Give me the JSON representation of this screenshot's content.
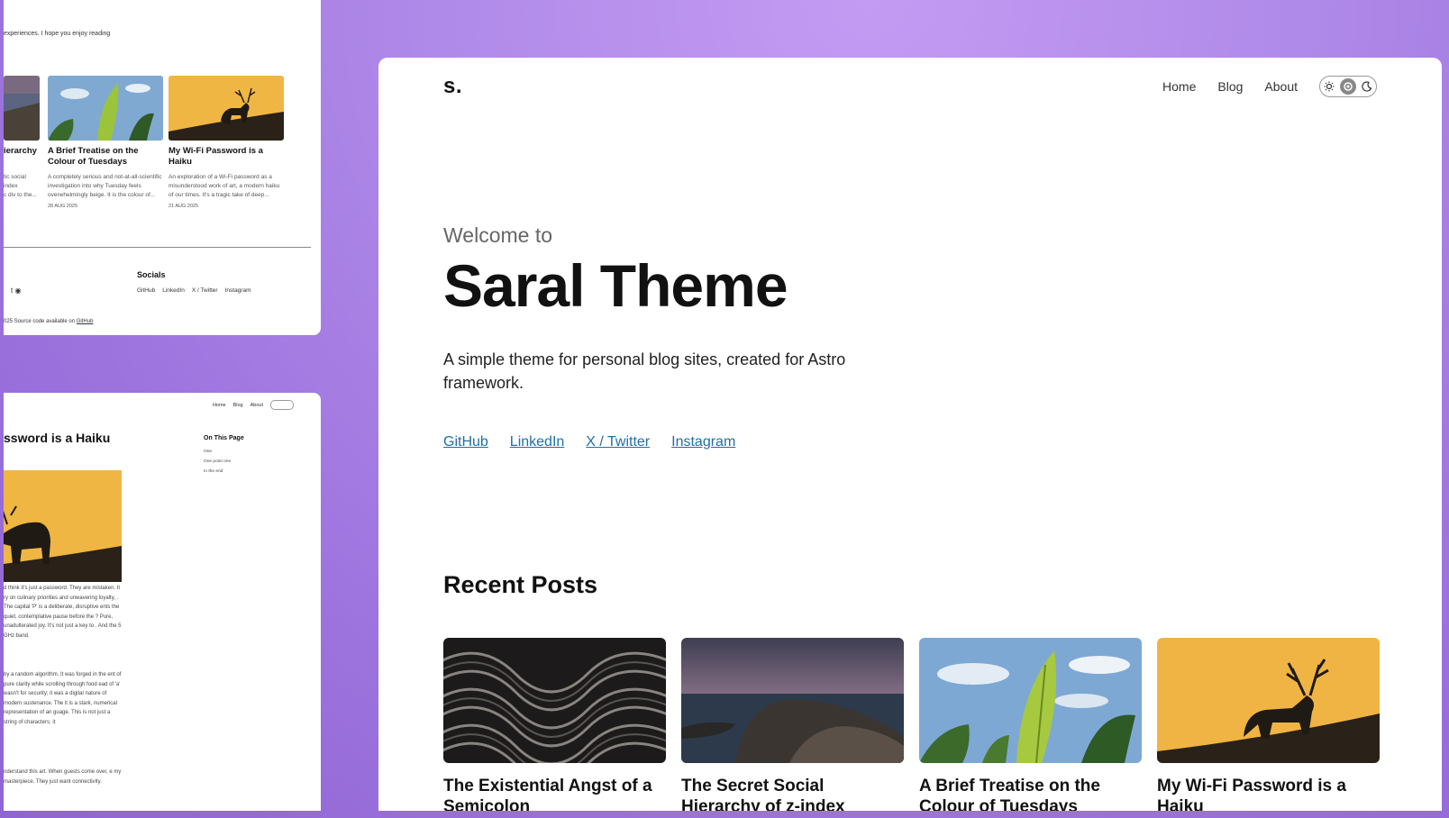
{
  "main": {
    "logo": "s.",
    "nav": [
      "Home",
      "Blog",
      "About"
    ],
    "hero": {
      "welcome": "Welcome to",
      "title": "Saral Theme",
      "subtitle": "A simple theme for personal blog sites, created for Astro framework.",
      "links": [
        "GitHub",
        "LinkedIn",
        "X / Twitter",
        "Instagram"
      ]
    },
    "recent_title": "Recent Posts",
    "posts": [
      {
        "title": "The Existential Angst of a Semicolon",
        "image": "wave-texture"
      },
      {
        "title": "The Secret Social Hierarchy of z-index",
        "image": "coastal-rocks"
      },
      {
        "title": "A Brief Treatise on the Colour of Tuesdays",
        "image": "banana-leaves"
      },
      {
        "title": "My Wi-Fi Password is a Haiku",
        "image": "stag-silhouette"
      }
    ]
  },
  "top_left": {
    "intro": "experiences. I hope you enjoy reading",
    "partial_title": "ierarchy",
    "partial_desc": "tic social\nindex\nc div to the...",
    "posts": [
      {
        "title": "A Brief Treatise on the Colour of Tuesdays",
        "desc": "A completely serious and not-at-all-scientific investigation into why Tuesday feels overwhelmingly beige. It is the colour of...",
        "date": "28 AUG 2025"
      },
      {
        "title": "My Wi-Fi Password is a Haiku",
        "desc": "An exploration of a Wi-Fi password as a misunderstood work of art, a modern haiku of our times. It's a tragic take of deep...",
        "date": "21 AUG 2025"
      }
    ],
    "socials_heading": "Socials",
    "socials": [
      "GitHub",
      "LinkedIn",
      "X / Twitter",
      "Instagram"
    ],
    "rss_partial": "t",
    "footer_prefix": "025 Source code available on ",
    "footer_link": "GitHub"
  },
  "bottom_left": {
    "nav": [
      "Home",
      "Blog",
      "About"
    ],
    "title": "ssword is a Haiku",
    "toc_heading": "On This Page",
    "toc": [
      "One",
      "One point one",
      "In the end"
    ],
    "para1": "d think it's just a password. They are mistaken. It ry on culinary priorities and unwavering loyalty, . The capital 'P' is a deliberate, disruptive ents the quiet, contemplative pause before the ? Pure, unadulterated joy. It's not just a key to . And the 5 GHz band.",
    "para2": "by a random algorithm. It was forged in the ent of pure clarity while scrolling through food ead of 'a' wasn't for security; it was a digital nature of modern sustenance. The it is a stark, numerical representation of an guage. This is not just a string of characters; it",
    "para3": "nderstand this art. When guests come over, e my masterpiece. They just want connectivity."
  }
}
